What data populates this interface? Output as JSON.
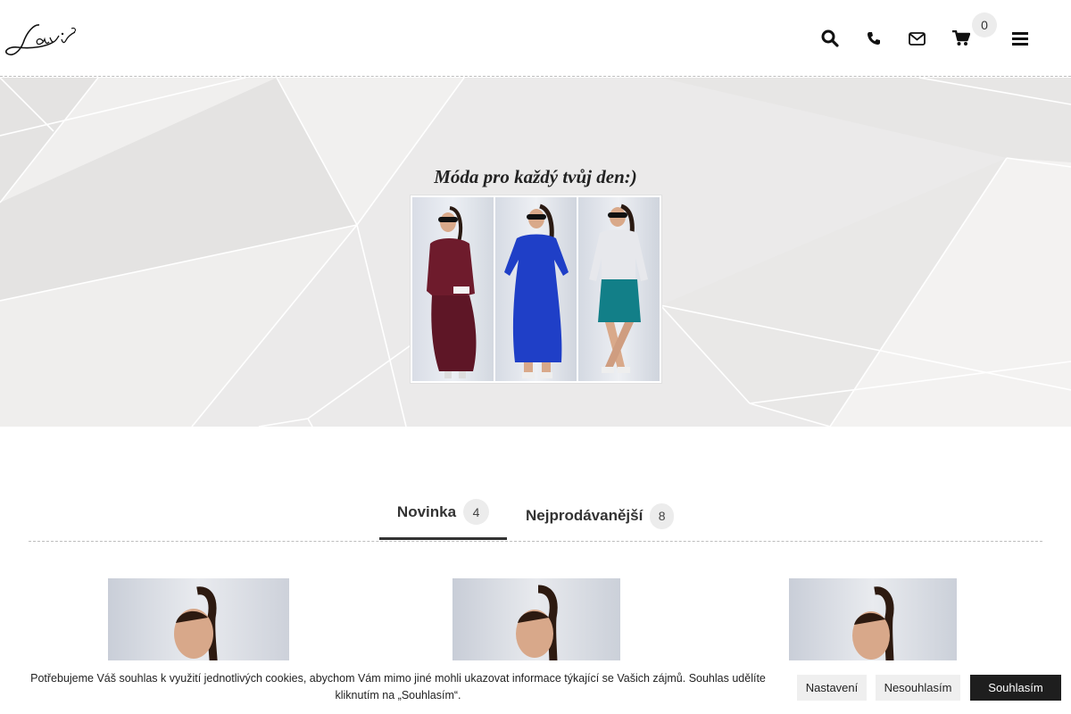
{
  "brand": {
    "logo_text": "Lavi"
  },
  "header": {
    "icons": [
      "search-icon",
      "phone-icon",
      "envelope-icon",
      "cart-icon",
      "hamburger-menu-icon"
    ],
    "cart_count": "0"
  },
  "hero": {
    "title": "Móda pro každý tvůj den:)"
  },
  "tabs": [
    {
      "label": "Novinka",
      "count": "4",
      "active": true
    },
    {
      "label": "Nejprodávanější",
      "count": "8",
      "active": false
    }
  ],
  "cookie": {
    "text": "Potřebujeme Váš souhlas k využití jednotlivých cookies, abychom Vám mimo jiné mohli ukazovat informace týkající se Vašich zájmů. Souhlas udělíte kliknutím na „Souhlasím“.",
    "settings_label": "Nastavení",
    "decline_label": "Nesouhlasím",
    "accept_label": "Souhlasím"
  },
  "colors": {
    "hero_bg": "#ebeaea",
    "dress_burgundy": "#6e1b2c",
    "dress_blue": "#1f3fc7",
    "skirt_teal": "#127f88",
    "accept_bg": "#1e1e1e"
  }
}
